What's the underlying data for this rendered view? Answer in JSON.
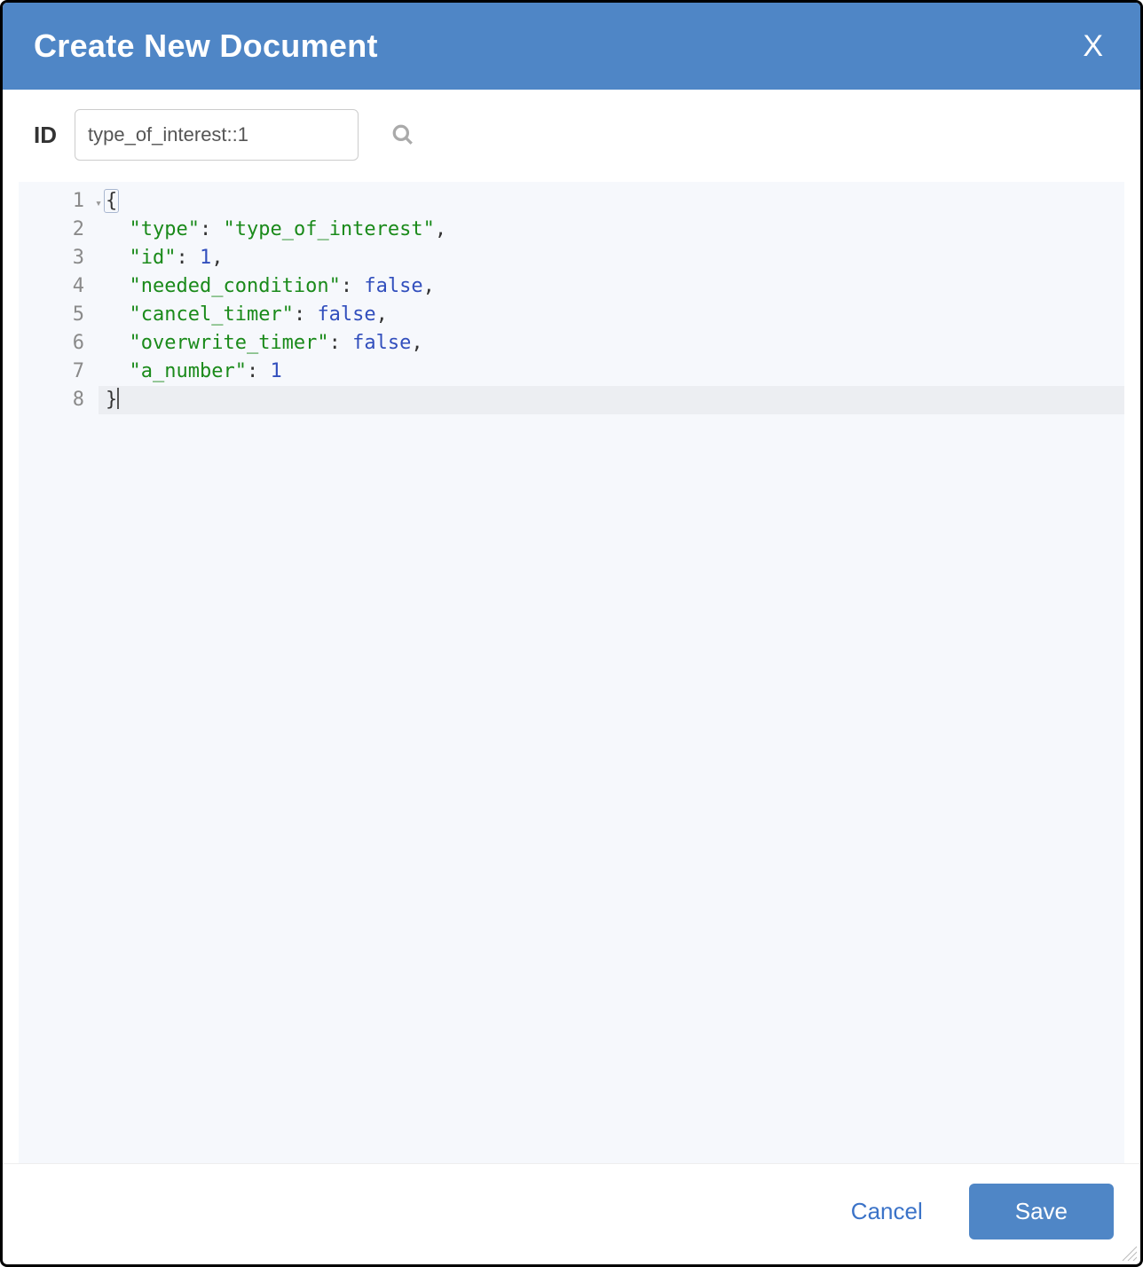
{
  "modal": {
    "title": "Create New Document",
    "close_label": "X"
  },
  "id_field": {
    "label": "ID",
    "value": "type_of_interest::1"
  },
  "editor": {
    "lines": [
      {
        "num": "1",
        "fold": true,
        "tokens": [
          {
            "t": "{",
            "c": "punct",
            "hl": true
          }
        ]
      },
      {
        "num": "2",
        "tokens": [
          {
            "t": "  ",
            "c": ""
          },
          {
            "t": "\"type\"",
            "c": "key"
          },
          {
            "t": ": ",
            "c": "punct"
          },
          {
            "t": "\"type_of_interest\"",
            "c": "str"
          },
          {
            "t": ",",
            "c": "punct"
          }
        ]
      },
      {
        "num": "3",
        "tokens": [
          {
            "t": "  ",
            "c": ""
          },
          {
            "t": "\"id\"",
            "c": "key"
          },
          {
            "t": ": ",
            "c": "punct"
          },
          {
            "t": "1",
            "c": "num"
          },
          {
            "t": ",",
            "c": "punct"
          }
        ]
      },
      {
        "num": "4",
        "tokens": [
          {
            "t": "  ",
            "c": ""
          },
          {
            "t": "\"needed_condition\"",
            "c": "key"
          },
          {
            "t": ": ",
            "c": "punct"
          },
          {
            "t": "false",
            "c": "bool"
          },
          {
            "t": ",",
            "c": "punct"
          }
        ]
      },
      {
        "num": "5",
        "tokens": [
          {
            "t": "  ",
            "c": ""
          },
          {
            "t": "\"cancel_timer\"",
            "c": "key"
          },
          {
            "t": ": ",
            "c": "punct"
          },
          {
            "t": "false",
            "c": "bool"
          },
          {
            "t": ",",
            "c": "punct"
          }
        ]
      },
      {
        "num": "6",
        "tokens": [
          {
            "t": "  ",
            "c": ""
          },
          {
            "t": "\"overwrite_timer\"",
            "c": "key"
          },
          {
            "t": ": ",
            "c": "punct"
          },
          {
            "t": "false",
            "c": "bool"
          },
          {
            "t": ",",
            "c": "punct"
          }
        ]
      },
      {
        "num": "7",
        "tokens": [
          {
            "t": "  ",
            "c": ""
          },
          {
            "t": "\"a_number\"",
            "c": "key"
          },
          {
            "t": ": ",
            "c": "punct"
          },
          {
            "t": "1",
            "c": "num"
          }
        ]
      },
      {
        "num": "8",
        "cursor": true,
        "tokens": [
          {
            "t": "}",
            "c": "punct"
          },
          {
            "caret": true
          }
        ]
      }
    ]
  },
  "footer": {
    "cancel_label": "Cancel",
    "save_label": "Save"
  }
}
